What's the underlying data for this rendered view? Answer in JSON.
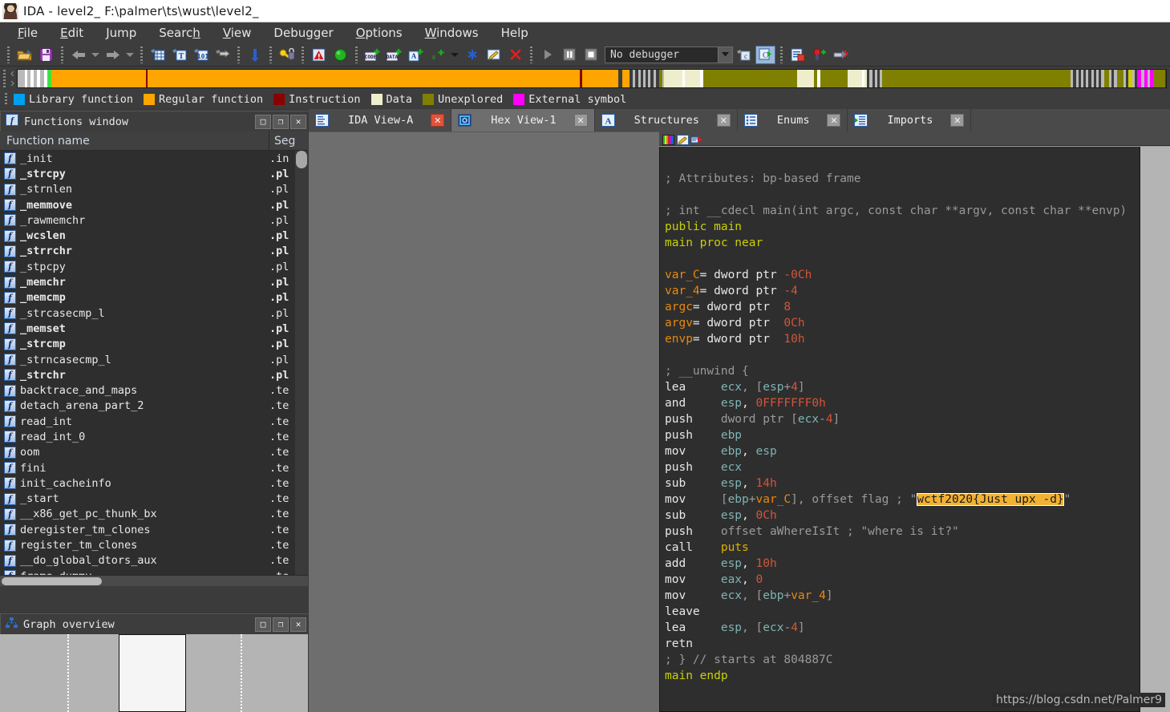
{
  "window": {
    "title": "IDA - level2_ F:\\palmer\\ts\\wust\\level2_",
    "icon": "avatar-icon"
  },
  "menu": [
    {
      "label": "File",
      "accel": "F"
    },
    {
      "label": "Edit",
      "accel": "E"
    },
    {
      "label": "Jump",
      "accel": "J"
    },
    {
      "label": "Search",
      "accel": "h"
    },
    {
      "label": "View",
      "accel": "V"
    },
    {
      "label": "Debugger",
      "accel": "g"
    },
    {
      "label": "Options",
      "accel": "O"
    },
    {
      "label": "Windows",
      "accel": "W"
    },
    {
      "label": "Help",
      "accel": ""
    }
  ],
  "toolbar": {
    "debugger_select_value": "No debugger",
    "buttons": [
      "open-icon",
      "save-icon",
      "back-icon",
      "back-dropdown-icon",
      "forward-icon",
      "forward-dropdown-icon",
      "jump-to-address-icon",
      "jump-to-text-icon",
      "jump-to-number-icon",
      "jump-xref-icon",
      "jump-down-icon",
      "search-key-icon",
      "warning-icon",
      "green-circle-icon",
      "make-code-icon",
      "make-data-icon",
      "make-ascii-icon",
      "make-struct-icon",
      "make-struct-dropdown-icon",
      "asterisk-icon",
      "edit-icon",
      "delete-icon"
    ],
    "debug_buttons": [
      "run-icon",
      "pause-icon",
      "stop-icon"
    ],
    "trailing_buttons": [
      "step-out-icon",
      "step-into-icon",
      "list-icon",
      "breakpoint-add-icon",
      "trace-icon"
    ]
  },
  "nav_band": {
    "segments": [
      {
        "color": "#b9b9b9",
        "w": 0.8
      },
      {
        "color": "#ffffff",
        "w": 0.35
      },
      {
        "color": "#b9b9b9",
        "w": 0.35
      },
      {
        "color": "#ffffff",
        "w": 0.35
      },
      {
        "color": "#b9b9b9",
        "w": 0.4
      },
      {
        "color": "#ffffff",
        "w": 0.35
      },
      {
        "color": "#b9b9b9",
        "w": 0.5
      },
      {
        "color": "#ffffff",
        "w": 0.35
      },
      {
        "color": "#3fe03f",
        "w": 0.5
      },
      {
        "color": "#ffa500",
        "w": 11.0
      },
      {
        "color": "#8b0000",
        "w": 0.25
      },
      {
        "color": "#ffa500",
        "w": 50.5
      },
      {
        "color": "#8b0000",
        "w": 0.3
      },
      {
        "color": "#ffa500",
        "w": 4.2
      },
      {
        "color": "#3d3d3d",
        "w": 0.45
      },
      {
        "color": "#ffa500",
        "w": 0.9
      },
      {
        "color": "#3d3d3d",
        "w": 0.35
      },
      {
        "color": "#b9b9b9",
        "w": 0.3
      },
      {
        "color": "#3d3d3d",
        "w": 0.3
      },
      {
        "color": "#b9b9b9",
        "w": 0.3
      },
      {
        "color": "#3d3d3d",
        "w": 0.3
      },
      {
        "color": "#b9b9b9",
        "w": 0.3
      },
      {
        "color": "#3d3d3d",
        "w": 0.3
      },
      {
        "color": "#b9b9b9",
        "w": 0.3
      },
      {
        "color": "#3d3d3d",
        "w": 0.3
      },
      {
        "color": "#b9b9b9",
        "w": 0.3
      },
      {
        "color": "#3d3d3d",
        "w": 0.35
      },
      {
        "color": "#808000",
        "w": 0.4
      },
      {
        "color": "#b9b9b9",
        "w": 0.25
      },
      {
        "color": "#eeeecc",
        "w": 2.1
      },
      {
        "color": "#ffffff",
        "w": 0.3
      },
      {
        "color": "#eeeecc",
        "w": 1.8
      },
      {
        "color": "#ffffff",
        "w": 0.35
      },
      {
        "color": "#808000",
        "w": 11.0
      },
      {
        "color": "#eeeecc",
        "w": 1.9
      },
      {
        "color": "#808000",
        "w": 0.45
      },
      {
        "color": "#ffffff",
        "w": 0.3
      },
      {
        "color": "#808000",
        "w": 3.2
      },
      {
        "color": "#eeeecc",
        "w": 1.7
      },
      {
        "color": "#ffffff",
        "w": 0.3
      },
      {
        "color": "#eeeecc",
        "w": 0.3
      },
      {
        "color": "#3d3d3d",
        "w": 0.3
      },
      {
        "color": "#b9b9b9",
        "w": 0.3
      },
      {
        "color": "#3d3d3d",
        "w": 0.3
      },
      {
        "color": "#b9b9b9",
        "w": 0.3
      },
      {
        "color": "#3d3d3d",
        "w": 0.3
      },
      {
        "color": "#b9b9b9",
        "w": 0.3
      },
      {
        "color": "#808000",
        "w": 22.0
      },
      {
        "color": "#b9b9b9",
        "w": 0.3
      },
      {
        "color": "#3d3d3d",
        "w": 0.3
      },
      {
        "color": "#b9b9b9",
        "w": 0.3
      },
      {
        "color": "#3d3d3d",
        "w": 0.3
      },
      {
        "color": "#b9b9b9",
        "w": 0.3
      },
      {
        "color": "#3d3d3d",
        "w": 0.3
      },
      {
        "color": "#b9b9b9",
        "w": 0.3
      },
      {
        "color": "#3d3d3d",
        "w": 0.3
      },
      {
        "color": "#b9b9b9",
        "w": 0.3
      },
      {
        "color": "#3d3d3d",
        "w": 0.3
      },
      {
        "color": "#b9b9b9",
        "w": 0.3
      },
      {
        "color": "#3d3d3d",
        "w": 0.3
      },
      {
        "color": "#b9b9b9",
        "w": 0.3
      },
      {
        "color": "#808000",
        "w": 0.6
      },
      {
        "color": "#b9b9b9",
        "w": 0.3
      },
      {
        "color": "#3d3d3d",
        "w": 0.3
      },
      {
        "color": "#b9b9b9",
        "w": 0.3
      },
      {
        "color": "#808000",
        "w": 0.8
      },
      {
        "color": "#b9b9b9",
        "w": 0.3
      },
      {
        "color": "#3d3d3d",
        "w": 0.3
      },
      {
        "color": "#cccc00",
        "w": 0.4
      },
      {
        "color": "#b9b9b9",
        "w": 0.3
      },
      {
        "color": "#3d3d3d",
        "w": 0.3
      },
      {
        "color": "#ff00ff",
        "w": 0.5
      },
      {
        "color": "#b9b9b9",
        "w": 0.3
      },
      {
        "color": "#ff00ff",
        "w": 0.4
      },
      {
        "color": "#b9b9b9",
        "w": 0.3
      },
      {
        "color": "#ff00ff",
        "w": 0.4
      },
      {
        "color": "#808000",
        "w": 1.4
      }
    ]
  },
  "legend": [
    {
      "label": "Library function",
      "color": "#00a0f0"
    },
    {
      "label": "Regular function",
      "color": "#ffa500"
    },
    {
      "label": "Instruction",
      "color": "#8b0000"
    },
    {
      "label": "Data",
      "color": "#eeeecc"
    },
    {
      "label": "Unexplored",
      "color": "#808000"
    },
    {
      "label": "External symbol",
      "color": "#ff00ff"
    }
  ],
  "functions_window": {
    "title": "Functions window",
    "icon": "function-icon",
    "window_buttons": [
      "maximize-icon",
      "restore-icon",
      "close-icon"
    ],
    "columns": [
      "Function name",
      "Seg"
    ],
    "rows": [
      {
        "name": "_init",
        "seg": ".in",
        "bold": false
      },
      {
        "name": "_strcpy",
        "seg": ".pl",
        "bold": true
      },
      {
        "name": "_strnlen",
        "seg": ".pl",
        "bold": false
      },
      {
        "name": "_memmove",
        "seg": ".pl",
        "bold": true
      },
      {
        "name": "_rawmemchr",
        "seg": ".pl",
        "bold": false
      },
      {
        "name": "_wcslen",
        "seg": ".pl",
        "bold": true
      },
      {
        "name": "_strrchr",
        "seg": ".pl",
        "bold": true
      },
      {
        "name": "_stpcpy",
        "seg": ".pl",
        "bold": false
      },
      {
        "name": "_memchr",
        "seg": ".pl",
        "bold": true
      },
      {
        "name": "_memcmp",
        "seg": ".pl",
        "bold": true
      },
      {
        "name": "_strcasecmp_l",
        "seg": ".pl",
        "bold": false
      },
      {
        "name": "_memset",
        "seg": ".pl",
        "bold": true
      },
      {
        "name": "_strcmp",
        "seg": ".pl",
        "bold": true
      },
      {
        "name": "_strncasecmp_l",
        "seg": ".pl",
        "bold": false
      },
      {
        "name": "_strchr",
        "seg": ".pl",
        "bold": true
      },
      {
        "name": "backtrace_and_maps",
        "seg": ".te",
        "bold": false
      },
      {
        "name": "detach_arena_part_2",
        "seg": ".te",
        "bold": false
      },
      {
        "name": "read_int",
        "seg": ".te",
        "bold": false
      },
      {
        "name": "read_int_0",
        "seg": ".te",
        "bold": false
      },
      {
        "name": "oom",
        "seg": ".te",
        "bold": false
      },
      {
        "name": "fini",
        "seg": ".te",
        "bold": false
      },
      {
        "name": "init_cacheinfo",
        "seg": ".te",
        "bold": false
      },
      {
        "name": "_start",
        "seg": ".te",
        "bold": false
      },
      {
        "name": "__x86_get_pc_thunk_bx",
        "seg": ".te",
        "bold": false
      },
      {
        "name": "deregister_tm_clones",
        "seg": ".te",
        "bold": false
      },
      {
        "name": "register_tm_clones",
        "seg": ".te",
        "bold": false
      },
      {
        "name": "__do_global_dtors_aux",
        "seg": ".te",
        "bold": false
      },
      {
        "name": "frame_dummy",
        "seg": ".te",
        "bold": false
      }
    ]
  },
  "graph_overview": {
    "title": "Graph overview",
    "icon": "graph-icon",
    "window_buttons": [
      "maximize-icon",
      "restore-icon",
      "close-icon"
    ]
  },
  "tabs": [
    {
      "label": "IDA View-A",
      "icon": "ida-view-icon",
      "active": false,
      "close": "close-icon",
      "close_style": "red"
    },
    {
      "label": "Hex View-1",
      "icon": "hex-view-icon",
      "active": true,
      "close": "close-icon",
      "close_style": "grey"
    },
    {
      "label": "Structures",
      "icon": "structures-icon",
      "active": false,
      "close": "close-icon",
      "close_style": "grey"
    },
    {
      "label": "Enums",
      "icon": "enums-icon",
      "active": false,
      "close": "close-icon",
      "close_style": "grey"
    },
    {
      "label": "Imports",
      "icon": "imports-icon",
      "active": false,
      "close": "close-icon",
      "close_style": "grey"
    }
  ],
  "disasm_tools": [
    "palette-icon",
    "edit-icon",
    "sync-icon"
  ],
  "disassembly": {
    "lines": [
      [],
      [
        {
          "t": "; Attributes: bp-based frame",
          "c": "c-cmt"
        }
      ],
      [],
      [
        {
          "t": "; int __cdecl main(int argc, const char **argv, const char **envp)",
          "c": "c-cmt"
        }
      ],
      [
        {
          "t": "public main",
          "c": "c-kw"
        }
      ],
      [
        {
          "t": "main proc near",
          "c": "c-kw"
        }
      ],
      [],
      [
        {
          "t": "var_C",
          "c": "c-name"
        },
        {
          "t": "= dword ptr ",
          "c": "c-ins"
        },
        {
          "t": "-0Ch",
          "c": "c-num"
        }
      ],
      [
        {
          "t": "var_4",
          "c": "c-name"
        },
        {
          "t": "= dword ptr ",
          "c": "c-ins"
        },
        {
          "t": "-4",
          "c": "c-num"
        }
      ],
      [
        {
          "t": "argc",
          "c": "c-name"
        },
        {
          "t": "= dword ptr  ",
          "c": "c-ins"
        },
        {
          "t": "8",
          "c": "c-num"
        }
      ],
      [
        {
          "t": "argv",
          "c": "c-name"
        },
        {
          "t": "= dword ptr  ",
          "c": "c-ins"
        },
        {
          "t": "0Ch",
          "c": "c-num"
        }
      ],
      [
        {
          "t": "envp",
          "c": "c-name"
        },
        {
          "t": "= dword ptr  ",
          "c": "c-ins"
        },
        {
          "t": "10h",
          "c": "c-num"
        }
      ],
      [],
      [
        {
          "t": "; __unwind {",
          "c": "c-cmt"
        }
      ],
      [
        {
          "t": "lea     ",
          "c": "c-ins"
        },
        {
          "t": "ecx",
          "c": "c-reg"
        },
        {
          "t": ", [",
          "c": "c-str"
        },
        {
          "t": "esp",
          "c": "c-reg"
        },
        {
          "t": "+",
          "c": "c-str"
        },
        {
          "t": "4",
          "c": "c-num"
        },
        {
          "t": "]",
          "c": "c-str"
        }
      ],
      [
        {
          "t": "and     ",
          "c": "c-ins"
        },
        {
          "t": "esp",
          "c": "c-reg"
        },
        {
          "t": ", ",
          "c": "c-ins"
        },
        {
          "t": "0FFFFFFF0h",
          "c": "c-num"
        }
      ],
      [
        {
          "t": "push    ",
          "c": "c-ins"
        },
        {
          "t": "dword ptr [",
          "c": "c-str"
        },
        {
          "t": "ecx",
          "c": "c-reg"
        },
        {
          "t": "-",
          "c": "c-str"
        },
        {
          "t": "4",
          "c": "c-num"
        },
        {
          "t": "]",
          "c": "c-str"
        }
      ],
      [
        {
          "t": "push    ",
          "c": "c-ins"
        },
        {
          "t": "ebp",
          "c": "c-reg"
        }
      ],
      [
        {
          "t": "mov     ",
          "c": "c-ins"
        },
        {
          "t": "ebp",
          "c": "c-reg"
        },
        {
          "t": ", ",
          "c": "c-ins"
        },
        {
          "t": "esp",
          "c": "c-reg"
        }
      ],
      [
        {
          "t": "push    ",
          "c": "c-ins"
        },
        {
          "t": "ecx",
          "c": "c-reg"
        }
      ],
      [
        {
          "t": "sub     ",
          "c": "c-ins"
        },
        {
          "t": "esp",
          "c": "c-reg"
        },
        {
          "t": ", ",
          "c": "c-ins"
        },
        {
          "t": "14h",
          "c": "c-num"
        }
      ],
      [
        {
          "t": "mov     ",
          "c": "c-ins"
        },
        {
          "t": "[",
          "c": "c-str"
        },
        {
          "t": "ebp",
          "c": "c-reg"
        },
        {
          "t": "+",
          "c": "c-str"
        },
        {
          "t": "var_C",
          "c": "c-name"
        },
        {
          "t": "], offset flag ",
          "c": "c-str"
        },
        {
          "t": "; ",
          "c": "c-cmt"
        },
        {
          "t": "\"",
          "c": "c-str"
        },
        {
          "t": "wctf2020{Just_upx_-d}",
          "c": "hl"
        },
        {
          "t": "\"",
          "c": "c-str"
        }
      ],
      [
        {
          "t": "sub     ",
          "c": "c-ins"
        },
        {
          "t": "esp",
          "c": "c-reg"
        },
        {
          "t": ", ",
          "c": "c-ins"
        },
        {
          "t": "0Ch",
          "c": "c-num"
        }
      ],
      [
        {
          "t": "push    ",
          "c": "c-ins"
        },
        {
          "t": "offset aWhereIsIt ",
          "c": "c-str"
        },
        {
          "t": "; ",
          "c": "c-cmt"
        },
        {
          "t": "\"where is it?\"",
          "c": "c-str"
        }
      ],
      [
        {
          "t": "call    ",
          "c": "c-ins"
        },
        {
          "t": "puts",
          "c": "c-call"
        }
      ],
      [
        {
          "t": "add     ",
          "c": "c-ins"
        },
        {
          "t": "esp",
          "c": "c-reg"
        },
        {
          "t": ", ",
          "c": "c-ins"
        },
        {
          "t": "10h",
          "c": "c-num"
        }
      ],
      [
        {
          "t": "mov     ",
          "c": "c-ins"
        },
        {
          "t": "eax",
          "c": "c-reg"
        },
        {
          "t": ", ",
          "c": "c-ins"
        },
        {
          "t": "0",
          "c": "c-num"
        }
      ],
      [
        {
          "t": "mov     ",
          "c": "c-ins"
        },
        {
          "t": "ecx",
          "c": "c-reg"
        },
        {
          "t": ", [",
          "c": "c-str"
        },
        {
          "t": "ebp",
          "c": "c-reg"
        },
        {
          "t": "+",
          "c": "c-str"
        },
        {
          "t": "var_4",
          "c": "c-name"
        },
        {
          "t": "]",
          "c": "c-str"
        }
      ],
      [
        {
          "t": "leave",
          "c": "c-ins"
        }
      ],
      [
        {
          "t": "lea     ",
          "c": "c-ins"
        },
        {
          "t": "esp",
          "c": "c-reg"
        },
        {
          "t": ", [",
          "c": "c-str"
        },
        {
          "t": "ecx",
          "c": "c-reg"
        },
        {
          "t": "-",
          "c": "c-str"
        },
        {
          "t": "4",
          "c": "c-num"
        },
        {
          "t": "]",
          "c": "c-str"
        }
      ],
      [
        {
          "t": "retn",
          "c": "c-ins"
        }
      ],
      [
        {
          "t": "; } // starts at 804887C",
          "c": "c-cmt"
        }
      ],
      [
        {
          "t": "main endp",
          "c": "c-kw"
        }
      ]
    ],
    "highlighted_string": "wctf2020{Just_upx_-d}"
  },
  "watermark": "https://blog.csdn.net/Palmer9",
  "colors": {
    "accent_orange": "#ffa500",
    "highlight": "#f2b233",
    "panel_bg": "#2e2e2e",
    "chrome_bg": "#3d3d3d"
  }
}
